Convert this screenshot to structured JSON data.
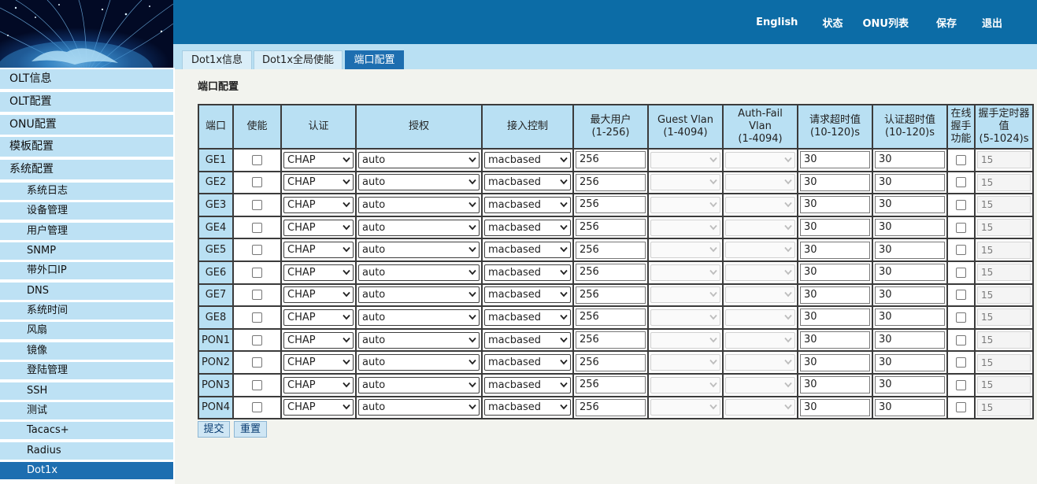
{
  "top_nav": [
    {
      "label": "English"
    },
    {
      "label": "状态"
    },
    {
      "label": "ONU列表"
    },
    {
      "label": "保存"
    },
    {
      "label": "退出"
    }
  ],
  "tabs": [
    {
      "label": "Dot1x信息",
      "active": false
    },
    {
      "label": "Dot1x全局使能",
      "active": false
    },
    {
      "label": "端口配置",
      "active": true
    }
  ],
  "sidebar": {
    "items": [
      {
        "label": "OLT信息",
        "level": "main"
      },
      {
        "label": "OLT配置",
        "level": "main"
      },
      {
        "label": "ONU配置",
        "level": "main"
      },
      {
        "label": "模板配置",
        "level": "main"
      },
      {
        "label": "系统配置",
        "level": "main"
      },
      {
        "label": "系统日志",
        "level": "sub"
      },
      {
        "label": "设备管理",
        "level": "sub"
      },
      {
        "label": "用户管理",
        "level": "sub"
      },
      {
        "label": "SNMP",
        "level": "sub"
      },
      {
        "label": "带外口IP",
        "level": "sub"
      },
      {
        "label": "DNS",
        "level": "sub"
      },
      {
        "label": "系统时间",
        "level": "sub"
      },
      {
        "label": "风扇",
        "level": "sub"
      },
      {
        "label": "镜像",
        "level": "sub"
      },
      {
        "label": "登陆管理",
        "level": "sub"
      },
      {
        "label": "SSH",
        "level": "sub"
      },
      {
        "label": "测试",
        "level": "sub"
      },
      {
        "label": "Tacacs+",
        "level": "sub"
      },
      {
        "label": "Radius",
        "level": "sub"
      },
      {
        "label": "Dot1x",
        "level": "sub",
        "active": true
      }
    ]
  },
  "section_title": "端口配置",
  "table": {
    "headers": [
      {
        "lines": [
          "端口"
        ]
      },
      {
        "lines": [
          "使能"
        ]
      },
      {
        "lines": [
          "认证"
        ]
      },
      {
        "lines": [
          "授权"
        ]
      },
      {
        "lines": [
          "接入控制"
        ]
      },
      {
        "lines": [
          "最大用户",
          "(1-256)"
        ]
      },
      {
        "lines": [
          "Guest Vlan",
          "(1-4094)"
        ]
      },
      {
        "lines": [
          "Auth-Fail",
          "Vlan",
          "(1-4094)"
        ]
      },
      {
        "lines": [
          "请求超时值",
          "(10-120)s"
        ]
      },
      {
        "lines": [
          "认证超时值",
          "(10-120)s"
        ]
      },
      {
        "lines": [
          "在线",
          "握手",
          "功能"
        ]
      },
      {
        "lines": [
          "握手定时器",
          "值",
          "(5-1024)s"
        ]
      }
    ],
    "rows": [
      {
        "port": "GE1",
        "enabled": false,
        "auth": "CHAP",
        "authz": "auto",
        "access": "macbased",
        "max_users": "256",
        "guest_vlan": "",
        "authfail_vlan": "",
        "req_timeout": "30",
        "auth_timeout": "30",
        "handshake": false,
        "handshake_timer": "15"
      },
      {
        "port": "GE2",
        "enabled": false,
        "auth": "CHAP",
        "authz": "auto",
        "access": "macbased",
        "max_users": "256",
        "guest_vlan": "",
        "authfail_vlan": "",
        "req_timeout": "30",
        "auth_timeout": "30",
        "handshake": false,
        "handshake_timer": "15"
      },
      {
        "port": "GE3",
        "enabled": false,
        "auth": "CHAP",
        "authz": "auto",
        "access": "macbased",
        "max_users": "256",
        "guest_vlan": "",
        "authfail_vlan": "",
        "req_timeout": "30",
        "auth_timeout": "30",
        "handshake": false,
        "handshake_timer": "15"
      },
      {
        "port": "GE4",
        "enabled": false,
        "auth": "CHAP",
        "authz": "auto",
        "access": "macbased",
        "max_users": "256",
        "guest_vlan": "",
        "authfail_vlan": "",
        "req_timeout": "30",
        "auth_timeout": "30",
        "handshake": false,
        "handshake_timer": "15"
      },
      {
        "port": "GE5",
        "enabled": false,
        "auth": "CHAP",
        "authz": "auto",
        "access": "macbased",
        "max_users": "256",
        "guest_vlan": "",
        "authfail_vlan": "",
        "req_timeout": "30",
        "auth_timeout": "30",
        "handshake": false,
        "handshake_timer": "15"
      },
      {
        "port": "GE6",
        "enabled": false,
        "auth": "CHAP",
        "authz": "auto",
        "access": "macbased",
        "max_users": "256",
        "guest_vlan": "",
        "authfail_vlan": "",
        "req_timeout": "30",
        "auth_timeout": "30",
        "handshake": false,
        "handshake_timer": "15"
      },
      {
        "port": "GE7",
        "enabled": false,
        "auth": "CHAP",
        "authz": "auto",
        "access": "macbased",
        "max_users": "256",
        "guest_vlan": "",
        "authfail_vlan": "",
        "req_timeout": "30",
        "auth_timeout": "30",
        "handshake": false,
        "handshake_timer": "15"
      },
      {
        "port": "GE8",
        "enabled": false,
        "auth": "CHAP",
        "authz": "auto",
        "access": "macbased",
        "max_users": "256",
        "guest_vlan": "",
        "authfail_vlan": "",
        "req_timeout": "30",
        "auth_timeout": "30",
        "handshake": false,
        "handshake_timer": "15"
      },
      {
        "port": "PON1",
        "enabled": false,
        "auth": "CHAP",
        "authz": "auto",
        "access": "macbased",
        "max_users": "256",
        "guest_vlan": "",
        "authfail_vlan": "",
        "req_timeout": "30",
        "auth_timeout": "30",
        "handshake": false,
        "handshake_timer": "15"
      },
      {
        "port": "PON2",
        "enabled": false,
        "auth": "CHAP",
        "authz": "auto",
        "access": "macbased",
        "max_users": "256",
        "guest_vlan": "",
        "authfail_vlan": "",
        "req_timeout": "30",
        "auth_timeout": "30",
        "handshake": false,
        "handshake_timer": "15"
      },
      {
        "port": "PON3",
        "enabled": false,
        "auth": "CHAP",
        "authz": "auto",
        "access": "macbased",
        "max_users": "256",
        "guest_vlan": "",
        "authfail_vlan": "",
        "req_timeout": "30",
        "auth_timeout": "30",
        "handshake": false,
        "handshake_timer": "15"
      },
      {
        "port": "PON4",
        "enabled": false,
        "auth": "CHAP",
        "authz": "auto",
        "access": "macbased",
        "max_users": "256",
        "guest_vlan": "",
        "authfail_vlan": "",
        "req_timeout": "30",
        "auth_timeout": "30",
        "handshake": false,
        "handshake_timer": "15"
      }
    ]
  },
  "buttons": {
    "submit": "提交",
    "reset": "重置"
  },
  "colors": {
    "topbar": "#0c6ca6",
    "sidebar_item": "#bde1f4",
    "active": "#1d6eb0",
    "header_cell": "#b9e0f3",
    "background": "#f2f3ee"
  },
  "icons": {
    "dropdown": "chevron-down-icon",
    "logo": "globe-fiber-logo"
  }
}
